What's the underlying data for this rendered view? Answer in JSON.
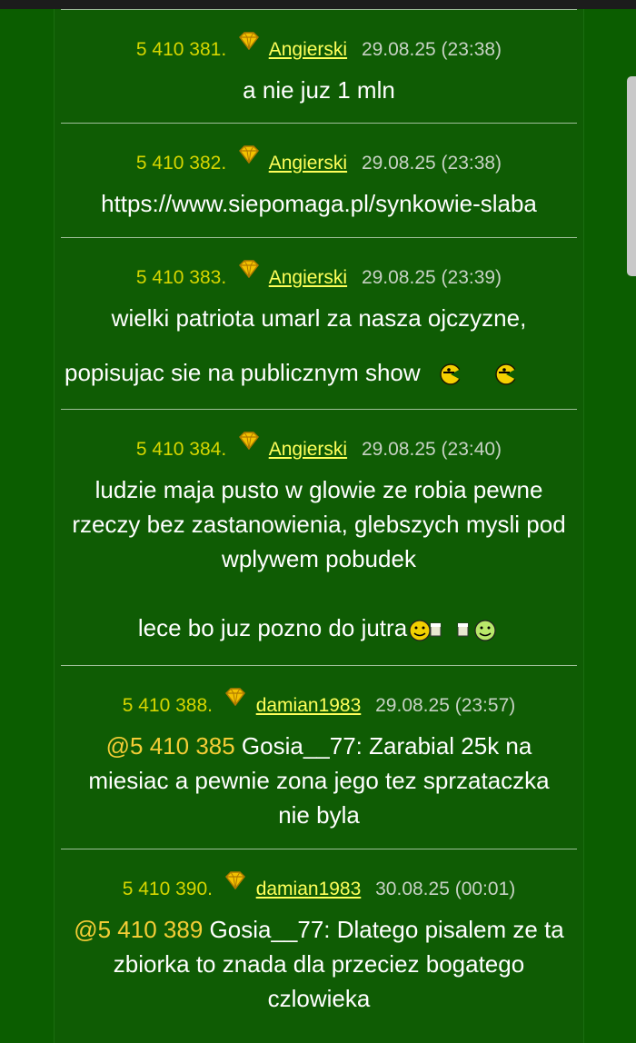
{
  "posts": [
    {
      "number": "5 410 381.",
      "author": "Angierski",
      "date": "29.08.25 (23:38)",
      "lines": [
        "a nie juz 1 mln"
      ]
    },
    {
      "number": "5 410 382.",
      "author": "Angierski",
      "date": "29.08.25 (23:38)",
      "lines": [
        "https://www.siepomaga.pl/synkowie-slaba"
      ]
    },
    {
      "number": "5 410 383.",
      "author": "Angierski",
      "date": "29.08.25 (23:39)",
      "lines": [
        "wielki patriota umarl za nasza ojczyzne,",
        "popisujac sie na publicznym show"
      ]
    },
    {
      "number": "5 410 384.",
      "author": "Angierski",
      "date": "29.08.25 (23:40)",
      "lines": [
        "ludzie maja pusto w glowie ze robia pewne rzeczy bez zastanowienia, glebszych mysli pod wplywem pobudek",
        "lece bo juz pozno do jutra"
      ]
    },
    {
      "number": "5 410 388.",
      "author": "damian1983",
      "date": "29.08.25 (23:57)",
      "quote_ref": "@5 410 385",
      "text": " Gosia__77: Zarabial 25k na miesiac a pewnie zona jego tez sprzataczka nie byla"
    },
    {
      "number": "5 410 390.",
      "author": "damian1983",
      "date": "30.08.25 (00:01)",
      "quote_ref": "@5 410 389",
      "text": " Gosia__77: Dlatego pisalem ze ta zbiorka to znada dla przeciez bogatego czlowieka"
    }
  ],
  "icons": {
    "rank": "diamond-rank-icon",
    "emoticons": [
      "pacman-emoticon-icon",
      "cheers-emoticon-icon"
    ]
  },
  "colors": {
    "background": "#0b5d00",
    "column": "#0f5c04",
    "post_number": "#d6d600",
    "author_link": "#ffff5a",
    "date": "#c7d2c4",
    "quote_ref": "#f4cd36"
  }
}
